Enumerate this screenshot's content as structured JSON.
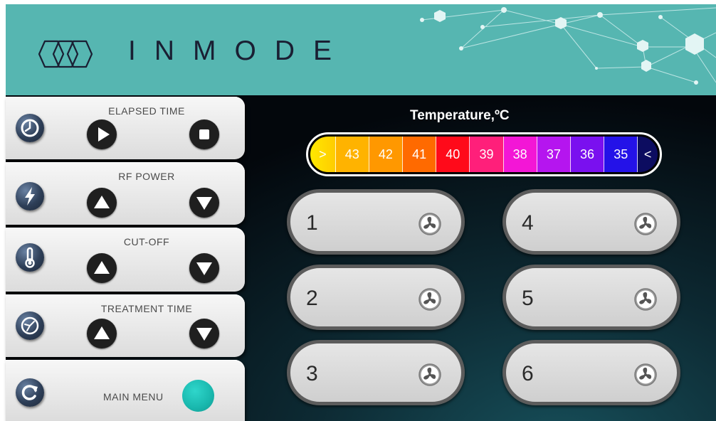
{
  "brand": {
    "name": "INMODE"
  },
  "colors": {
    "header": "#56b6b1",
    "accent": "#19b7ad",
    "background": "#03070c"
  },
  "sidebar": {
    "elapsed_time": {
      "label": "ELAPSED TIME",
      "icon": "clock-icon",
      "buttons": [
        "play-icon",
        "stop-icon"
      ]
    },
    "rf_power": {
      "label": "RF POWER",
      "icon": "lightning-icon",
      "buttons": [
        "arrow-up-icon",
        "arrow-down-icon"
      ]
    },
    "cut_off": {
      "label": "CUT-OFF",
      "icon": "thermometer-icon",
      "buttons": [
        "arrow-up-icon",
        "arrow-down-icon"
      ]
    },
    "treatment_time": {
      "label": "TREATMENT TIME",
      "icon": "timer-icon",
      "buttons": [
        "arrow-up-icon",
        "arrow-down-icon"
      ]
    },
    "main_menu": {
      "label": "MAIN MENU",
      "icon": "refresh-icon"
    }
  },
  "temperature": {
    "title": "Temperature,ºC",
    "start_marker": ">",
    "end_marker": "<",
    "scale": [
      {
        "value": "43",
        "color": "#ffb300"
      },
      {
        "value": "42",
        "color": "#ff9800"
      },
      {
        "value": "41",
        "color": "#ff6a00"
      },
      {
        "value": "40",
        "color": "#ff0a1a"
      },
      {
        "value": "39",
        "color": "#ff1f7a"
      },
      {
        "value": "38",
        "color": "#f316d6"
      },
      {
        "value": "37",
        "color": "#b515ef"
      },
      {
        "value": "36",
        "color": "#7a10ef"
      },
      {
        "value": "35",
        "color": "#2412e8"
      }
    ]
  },
  "zones": [
    {
      "number": "1",
      "icon": "fan-icon"
    },
    {
      "number": "2",
      "icon": "fan-icon"
    },
    {
      "number": "3",
      "icon": "fan-icon"
    },
    {
      "number": "4",
      "icon": "fan-icon"
    },
    {
      "number": "5",
      "icon": "fan-icon"
    },
    {
      "number": "6",
      "icon": "fan-icon"
    }
  ]
}
